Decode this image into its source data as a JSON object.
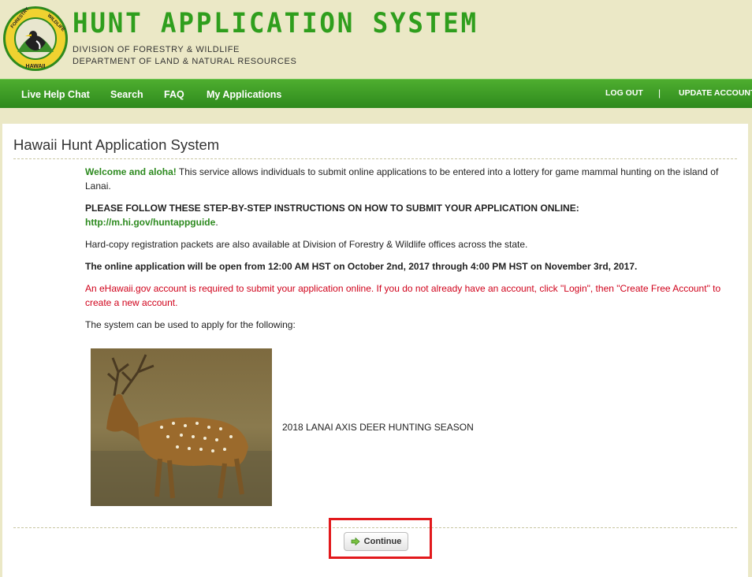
{
  "header": {
    "title": "HUNT APPLICATION SYSTEM",
    "division": "DIVISION OF FORESTRY & WILDLIFE",
    "department": "DEPARTMENT OF LAND & NATURAL RESOURCES",
    "logo_text_top": "FORESTRY AND WILDLIFE",
    "logo_text_bottom": "HAWAII"
  },
  "nav": {
    "items": [
      "Live Help Chat",
      "Search",
      "FAQ",
      "My Applications"
    ],
    "logout": "LOG OUT",
    "separator": "|",
    "update_account": "UPDATE ACCOUNT"
  },
  "main": {
    "heading": "Hawaii Hunt Application System",
    "welcome": "Welcome and aloha!",
    "intro": " This service allows individuals to submit online applications to be entered into a lottery for game mammal hunting on the island of Lanai.",
    "instructions_heading": "PLEASE FOLLOW THESE STEP-BY-STEP INSTRUCTIONS ON HOW TO SUBMIT YOUR APPLICATION ONLINE:",
    "guide_link": "http://m.hi.gov/huntappguide",
    "guide_suffix": ".",
    "hardcopy": "Hard-copy registration packets are also available at Division of Forestry & Wildlife offices across the state.",
    "open_dates": "The online application will be open from 12:00 AM HST on October 2nd, 2017 through 4:00 PM HST on November 3rd, 2017.",
    "account_notice": "An eHawaii.gov account is required to submit your application online. If you do not already have an account, click \"Login\", then \"Create Free Account\" to create a new account.",
    "system_use": "The system can be used to apply for the following:",
    "season": "2018 LANAI AXIS DEER HUNTING SEASON",
    "continue_label": "Continue",
    "continue_icon": "arrow-right-icon"
  },
  "colors": {
    "accent_green": "#2f9e1d",
    "nav_green": "#3a9a24",
    "highlight_red": "#e2191c",
    "notice_red": "#d0021b"
  }
}
